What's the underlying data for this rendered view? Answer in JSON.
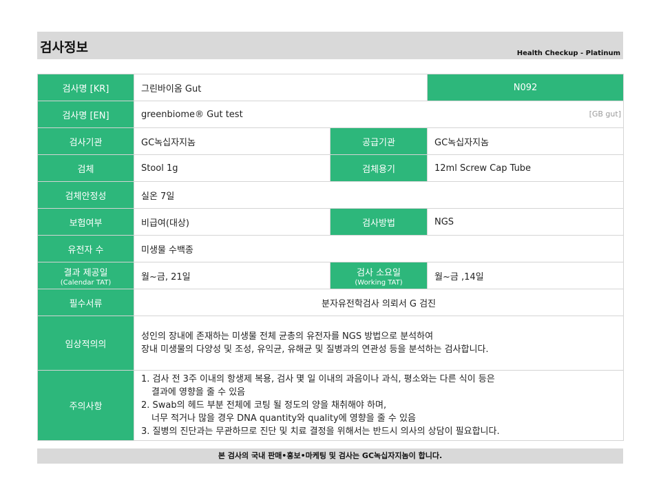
{
  "header": {
    "title": "검사정보",
    "subtitle": "Health Checkup - Platinum"
  },
  "rows": {
    "name_kr": {
      "label": "검사명 [KR]",
      "value": "그린바이옴 Gut",
      "code": "N092"
    },
    "name_en": {
      "label": "검사명 [EN]",
      "value": "greenbiome® Gut test",
      "tag": "[GB gut]"
    },
    "institution": {
      "label": "검사기관",
      "value": "GC녹십자지놈",
      "label2": "공급기관",
      "value2": "GC녹십자지놈"
    },
    "specimen": {
      "label": "검체",
      "value": "Stool 1g",
      "label2": "검체용기",
      "value2": "12ml Screw Cap Tube"
    },
    "stability": {
      "label": "검체안정성",
      "value": "실온 7일"
    },
    "insurance": {
      "label": "보험여부",
      "value": "비급여(대상)",
      "label2": "검사방법",
      "value2": "NGS"
    },
    "genes": {
      "label": "유전자 수",
      "value": "미생물 수백종"
    },
    "tat": {
      "label": "결과 제공일",
      "label_sub": "(Calendar TAT)",
      "value": "월~금, 21일",
      "label2": "검사 소요일",
      "label2_sub": "(Working TAT)",
      "value2": "월~금 ,14일"
    },
    "documents": {
      "label": "필수서류",
      "value": "분자유전학검사 의뢰서 G 검진"
    },
    "clinical": {
      "label": "임상적의의",
      "lines": [
        "성인의 장내에 존재하는 미생물 전체 균총의 유전자를 NGS 방법으로 분석하여",
        "장내 미생물의 다양성 및 조성, 유익균, 유해균 및 질병과의 연관성 등을 분석하는 검사합니다."
      ]
    },
    "notes": {
      "label": "주의사항",
      "lines": [
        "1. 검사 전 3주 이내의 항생제 복용, 검사 몇 일 이내의 과음이나 과식, 평소와는 다른 식이 등은",
        "결과에 영향을 줄 수 있음",
        "2. Swab의 헤드 부분 전체에 코팅 될 정도의 양을 채취해야 하며,",
        "너무 적거나 많을 경우 DNA quantity와 quality에 영향을 줄 수 있음",
        "3. 질병의 진단과는 무관하므로 진단 및 치료 결정을 위해서는 반드시 의사의 상담이 필요합니다."
      ]
    }
  },
  "footer": "본 검사의 국내 판매•홍보•마케팅 및 검사는 GC녹십자지놈이 합니다."
}
